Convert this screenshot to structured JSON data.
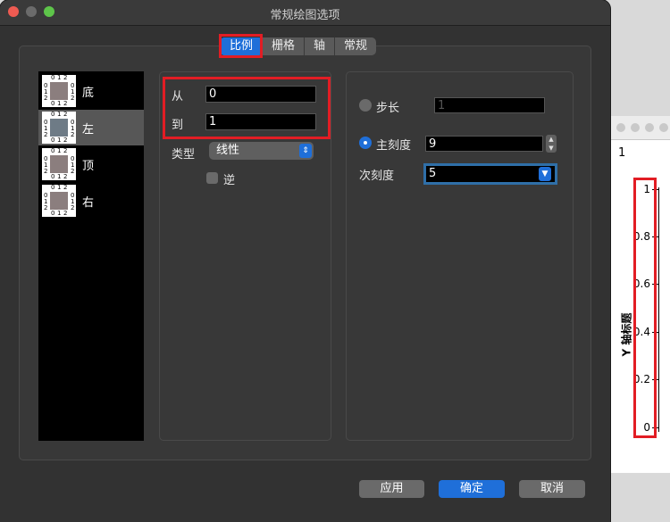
{
  "dialog": {
    "title": "常规绘图选项"
  },
  "tabs": [
    {
      "label": "比例",
      "selected": true
    },
    {
      "label": "栅格",
      "selected": false
    },
    {
      "label": "轴",
      "selected": false
    },
    {
      "label": "常规",
      "selected": false
    }
  ],
  "sidebar": {
    "items": [
      {
        "label": "底",
        "selected": false
      },
      {
        "label": "左",
        "selected": true
      },
      {
        "label": "顶",
        "selected": false
      },
      {
        "label": "右",
        "selected": false
      }
    ],
    "icon_ticks": [
      "0",
      "1",
      "2"
    ]
  },
  "scale": {
    "from_label": "从",
    "from_value": "0",
    "to_label": "到",
    "to_value": "1",
    "type_label": "类型",
    "type_value": "线性",
    "reverse_label": "逆"
  },
  "ticks": {
    "step_label": "步长",
    "step_value": "1",
    "major_label": "主刻度",
    "major_value": "9",
    "minor_label": "次刻度",
    "minor_value": "5"
  },
  "buttons": {
    "apply": "应用",
    "ok": "确定",
    "cancel": "取消"
  },
  "background_plot": {
    "corner_label": "1",
    "axis_title": "Y 轴标题",
    "tick_labels": [
      "1",
      "0.8",
      "0.6",
      "0.4",
      "0.2",
      "0"
    ]
  },
  "colors": {
    "accent": "#1f6fd9",
    "highlight": "#e21d24",
    "close": "#ee5b52",
    "minimize": "#f5bd4f",
    "maximize": "#5ec54a"
  }
}
